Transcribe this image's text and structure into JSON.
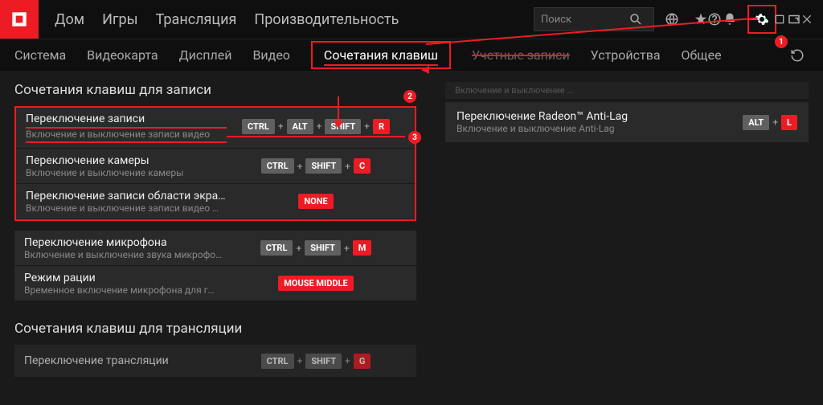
{
  "titlebar": {
    "nav": [
      "Дом",
      "Игры",
      "Трансляция",
      "Производительность"
    ],
    "search_placeholder": "Поиск"
  },
  "subnav": {
    "tabs": [
      "Система",
      "Видеокарта",
      "Дисплей",
      "Видео",
      "Сочетания клавиш",
      "Учетные записи",
      "Устройства",
      "Общее"
    ],
    "active_index": 4,
    "struck_index": 5
  },
  "sections": {
    "recording_title": "Сочетания клавиш для записи",
    "streaming_title": "Сочетания клавиш для трансляции"
  },
  "hotkeys": {
    "group1": [
      {
        "title": "Переключение записи",
        "desc": "Включение и выключение записи видео",
        "keys": [
          "CTRL",
          "ALT",
          "SHIFT"
        ],
        "final": "R",
        "underline": true
      },
      {
        "title": "Переключение камеры",
        "desc": "Включение и выключение камеры",
        "keys": [
          "CTRL",
          "SHIFT"
        ],
        "final": "C"
      },
      {
        "title": "Переключение записи области экра…",
        "desc": "Включение и выключение записи видео …",
        "keys": [],
        "final": "NONE"
      }
    ],
    "group2": [
      {
        "title": "Переключение микрофона",
        "desc": "Включение и выключение звука микрофо…",
        "keys": [
          "CTRL",
          "SHIFT"
        ],
        "final": "M"
      },
      {
        "title": "Режим рации",
        "desc": "Временное включение микрофона для г…",
        "keys": [],
        "final": "MOUSE MIDDLE"
      }
    ],
    "stream_row": {
      "title": "Переключение трансляции",
      "keys": [
        "CTRL",
        "SHIFT"
      ],
      "final": "G"
    }
  },
  "right": {
    "scribble": "Включение и выключение …",
    "antilag": {
      "title": "Переключение Radeon™ Anti-Lag",
      "desc": "Включение и выключение Anti-Lag",
      "keys": [
        "ALT"
      ],
      "final": "L"
    }
  },
  "markers": {
    "m1": "1",
    "m2": "2",
    "m3": "3"
  }
}
